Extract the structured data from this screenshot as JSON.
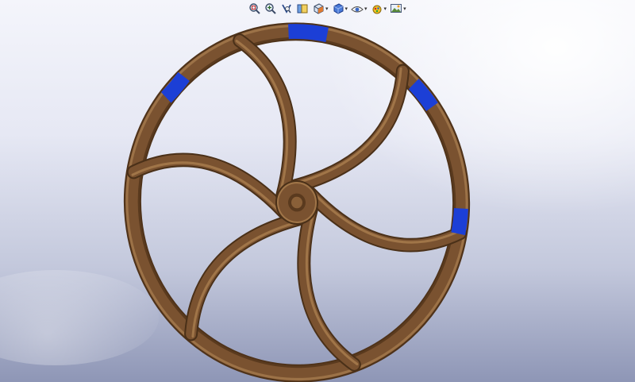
{
  "graphics_area": {
    "background_top": "#f4f5fb",
    "background_bottom": "#8e96b6"
  },
  "heads_up_toolbar": {
    "buttons": [
      {
        "icon": "zoom-to-fit-icon",
        "has_menu": false
      },
      {
        "icon": "zoom-to-area-icon",
        "has_menu": false
      },
      {
        "icon": "previous-view-icon",
        "has_menu": false
      },
      {
        "icon": "section-view-icon",
        "has_menu": false
      },
      {
        "icon": "view-orientation-icon",
        "has_menu": true
      },
      {
        "icon": "display-style-icon",
        "has_menu": true
      },
      {
        "icon": "hide-show-items-icon",
        "has_menu": true
      },
      {
        "icon": "edit-appearance-icon",
        "has_menu": true
      },
      {
        "icon": "apply-scene-icon",
        "has_menu": true
      }
    ]
  },
  "model": {
    "part": "spiral-spoke-wheel",
    "spoke_count": 6,
    "body_color": "#7a5230",
    "highlight_color": "#9c7247",
    "shadow_color": "#4a3018",
    "selected_face_color": "#1c3fd6"
  }
}
